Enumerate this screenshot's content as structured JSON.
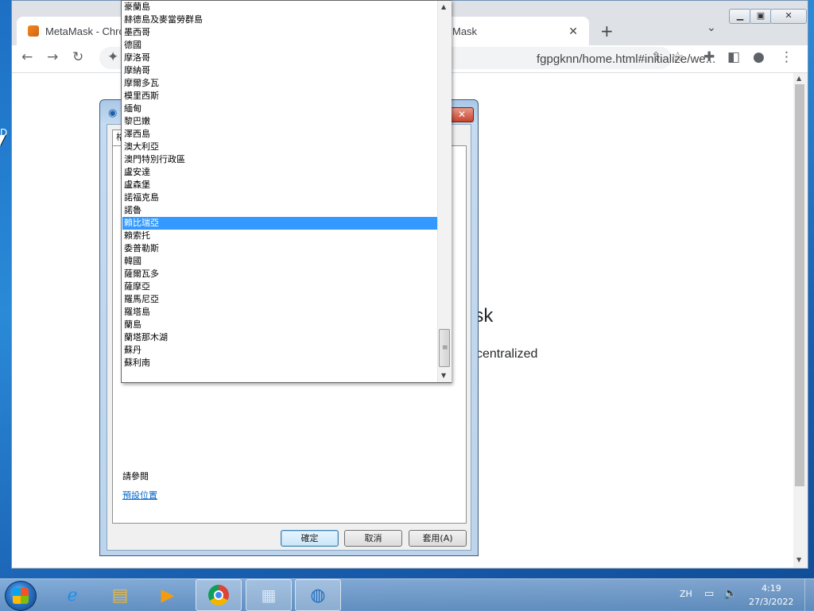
{
  "browser": {
    "tabs": [
      {
        "label": "MetaMask - Chro"
      },
      {
        "label": "Mask"
      }
    ],
    "new_tab_symbol": "+",
    "tab_close_symbol": "✕",
    "url_partial": "fgpgknn/home.html#initialize/we...",
    "page_heading": "ask",
    "page_subtitle": "centralized"
  },
  "dialog": {
    "tab_label": "格",
    "see_also": "請參閱",
    "default_location_link": "預設位置",
    "ok_label": "確定",
    "cancel_label": "取消",
    "apply_label": "套用(A)"
  },
  "dropdown": {
    "items": [
      "豪蘭島",
      "赫德島及麥當勞群島",
      "墨西哥",
      "德國",
      "摩洛哥",
      "摩納哥",
      "摩爾多瓦",
      "模里西斯",
      "緬甸",
      "黎巴嫩",
      "澤西島",
      "澳大利亞",
      "澳門特別行政區",
      "盧安達",
      "盧森堡",
      "諾福克島",
      "諾魯",
      "賴比瑞亞",
      "賴索托",
      "委普勒斯",
      "韓國",
      "薩爾瓦多",
      "薩摩亞",
      "羅馬尼亞",
      "羅塔島",
      "蘭島",
      "蘭塔那木湖",
      "蘇丹",
      "蘇利南"
    ],
    "selected_index": 17
  },
  "taskbar": {
    "language": "ZH",
    "time": "4:19",
    "date": "27/3/2022"
  },
  "desktop": {
    "edge_letter": "D"
  }
}
